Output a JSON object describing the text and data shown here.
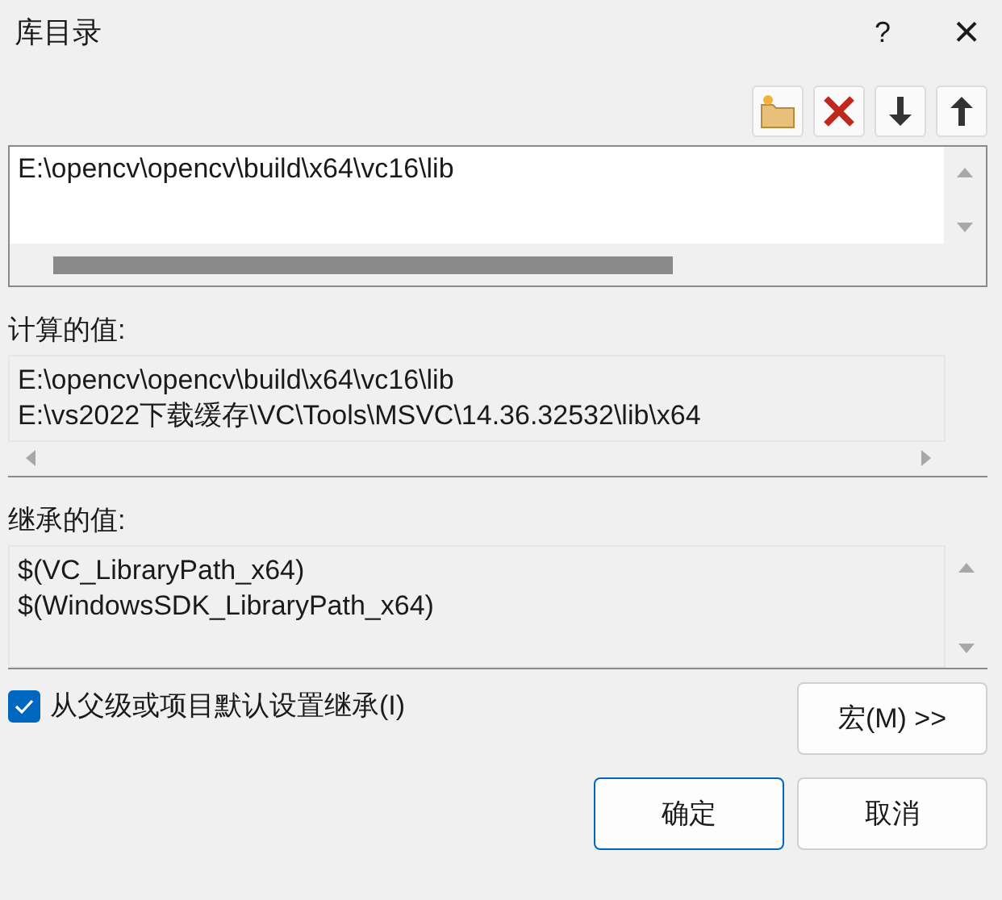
{
  "window": {
    "title": "库目录",
    "help": "?",
    "close": "×"
  },
  "toolbar": [
    {
      "kind": "new-folder"
    },
    {
      "kind": "delete"
    },
    {
      "kind": "move-down"
    },
    {
      "kind": "move-up"
    }
  ],
  "edit_list": {
    "lines": [
      "E:\\opencv\\opencv\\build\\x64\\vc16\\lib"
    ]
  },
  "computed": {
    "label": "计算的值:",
    "lines": [
      "E:\\opencv\\opencv\\build\\x64\\vc16\\lib",
      "E:\\vs2022下载缓存\\VC\\Tools\\MSVC\\14.36.32532\\lib\\x64"
    ]
  },
  "inherited": {
    "label": "继承的值:",
    "lines": [
      "$(VC_LibraryPath_x64)",
      "$(WindowsSDK_LibraryPath_x64)"
    ]
  },
  "inherit_checkbox": {
    "label": "从父级或项目默认设置继承(I)",
    "checked": true
  },
  "macro_button": "宏(M) >>",
  "buttons": [
    {
      "label": "确定",
      "default": true
    },
    {
      "label": "取消",
      "default": false
    }
  ]
}
